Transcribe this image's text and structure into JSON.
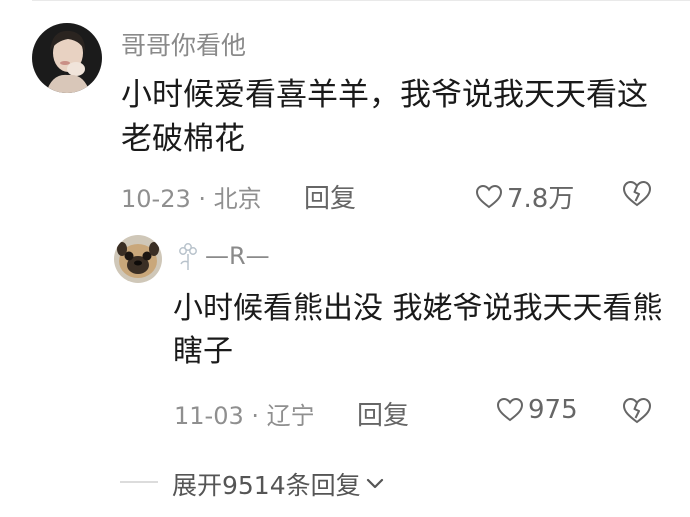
{
  "comment": {
    "username": "哥哥你看他",
    "text": "小时候爱看喜羊羊，我爷说我天天看这老破棉花",
    "date": "10-23",
    "separator": "·",
    "location": "北京",
    "reply_label": "回复",
    "like_count": "7.8万",
    "avatar_icon": "girl-photo-avatar",
    "like_icon": "heart-outline-icon",
    "dislike_icon": "broken-heart-icon",
    "reply": {
      "username": "—R—",
      "text": "小时候看熊出没 我姥爷说我天天看熊瞎子",
      "date": "11-03",
      "separator": "·",
      "location": "辽宁",
      "reply_label": "回复",
      "like_count": "975",
      "avatar_icon": "pug-dog-avatar",
      "badge_icon": "small-flower-icon"
    }
  },
  "expand": {
    "label": "展开9514条回复",
    "icon": "chevron-down-icon"
  },
  "colors": {
    "text": "#1a1a1a",
    "username": "#8a8a8a",
    "meta": "#8f8f8f",
    "action": "#666666"
  }
}
